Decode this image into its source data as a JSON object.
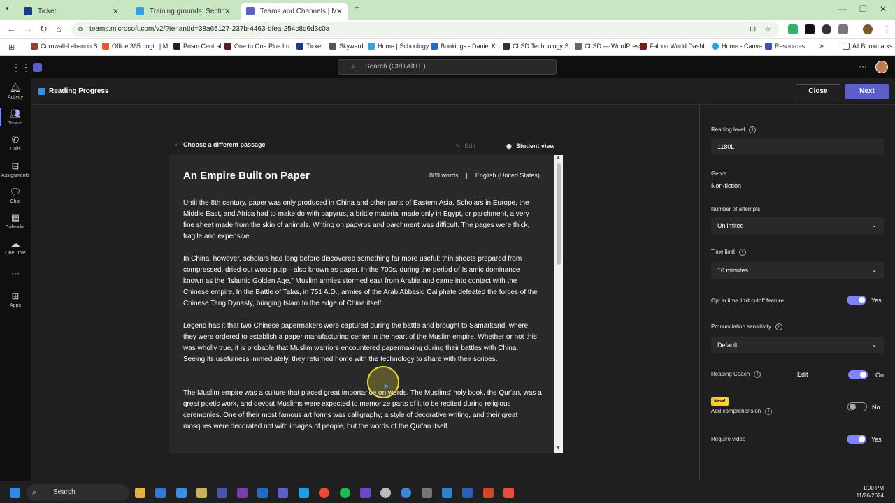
{
  "browser": {
    "tabs": [
      {
        "label": "Ticket"
      },
      {
        "label": "Training grounds: Section 1 | Sc"
      },
      {
        "label": "Teams and Channels | Microsof"
      }
    ],
    "url": "teams.microsoft.com/v2/?tenantId=38a65127-237b-4463-bfea-254c8d6d3c0a",
    "bookmarks": [
      "Cornwall-Lebanon S...",
      "Office 365 Login | M...",
      "Prism Central",
      "One to One Plus Lo...",
      "Ticket",
      "Skyward",
      "Home | Schoology",
      "Bookings - Daniel K...",
      "CLSD Technology S...",
      "CLSD — WordPress",
      "Falcon World Dashb...",
      "Home - Canva",
      "Resources"
    ],
    "all_bookmarks": "All Bookmarks"
  },
  "teams": {
    "search_placeholder": "Search (Ctrl+Alt+E)",
    "rail": [
      {
        "label": "Activity",
        "icon": "bell-icon"
      },
      {
        "label": "Teams",
        "icon": "teams-icon"
      },
      {
        "label": "Calls",
        "icon": "phone-icon"
      },
      {
        "label": "Assignments",
        "icon": "bag-icon"
      },
      {
        "label": "Chat",
        "icon": "chat-icon"
      },
      {
        "label": "Calendar",
        "icon": "calendar-icon"
      },
      {
        "label": "OneDrive",
        "icon": "cloud-icon"
      },
      {
        "label": "Apps",
        "icon": "apps-icon"
      }
    ]
  },
  "header": {
    "title": "Reading Progress",
    "close": "Close",
    "next": "Next"
  },
  "passage": {
    "back": "Choose a different passage",
    "edit": "Edit",
    "student_view": "Student view",
    "title": "An Empire Built on Paper",
    "words": "889 words",
    "sep": "|",
    "language": "English (United States)",
    "paragraphs": [
      "Until the 8th century, paper was only produced in China and other parts of Eastern Asia. Scholars in Europe, the Middle East, and Africa had to make do with papyrus, a brittle material made only in Egypt, or parchment, a very fine sheet made from the skin of animals. Writing on papyrus and parchment was difficult. The pages were thick, fragile and expensive.",
      "In China, however, scholars had long before discovered something far more useful: thin sheets prepared from compressed, dried-out wood pulp—also known as paper. In the 700s, during the period of Islamic dominance known as the \"Islamic Golden Age,\" Muslim armies stormed east from Arabia and came into contact with the Chinese empire. In the Battle of Talas, in 751 A.D., armies of the Arab Abbasid Caliphate defeated the forces of the Chinese Tang Dynasty, bringing Islam to the edge of China itself.",
      "Legend has it that two Chinese papermakers were captured during the battle and brought to Samarkand, where they were ordered to establish a paper manufacturing center in the heart of the Muslim empire. Whether or not this was wholly true, it is probable that Muslim warriors encountered papermaking during their battles with China. Seeing its usefulness immediately, they returned home with the technology to share with their scribes.",
      "The Muslim empire was a culture that placed great importance on words. The Muslims' holy book, the Qur'an, was a great poetic work, and devout Muslims were expected to memorize parts of it to be recited during religious ceremonies. One of their most famous art forms was calligraphy, a style of decorative writing, and their great mosques were decorated not with images of people, but the words of the Qur'an itself."
    ]
  },
  "settings": {
    "reading_level_label": "Reading level",
    "reading_level": "1180L",
    "genre_label": "Genre",
    "genre": "Non-fiction",
    "attempts_label": "Number of attempts",
    "attempts": "Unlimited",
    "time_limit_label": "Time limit",
    "time_limit": "10 minutes",
    "cutoff_label": "Opt in time limit cutoff feature.",
    "cutoff_state": "Yes",
    "pron_label": "Pronunciation sensitivity",
    "pron": "Default",
    "coach_label": "Reading Coach",
    "coach_edit": "Edit",
    "coach_state": "On",
    "new_badge": "New!",
    "comprehension_label": "Add comprehension",
    "comprehension_state": "No",
    "video_label": "Require video",
    "video_state": "Yes",
    "accent": "#7f85f5"
  },
  "taskbar": {
    "search": "Search",
    "time": "1:00 PM",
    "date": "11/26/2024"
  }
}
